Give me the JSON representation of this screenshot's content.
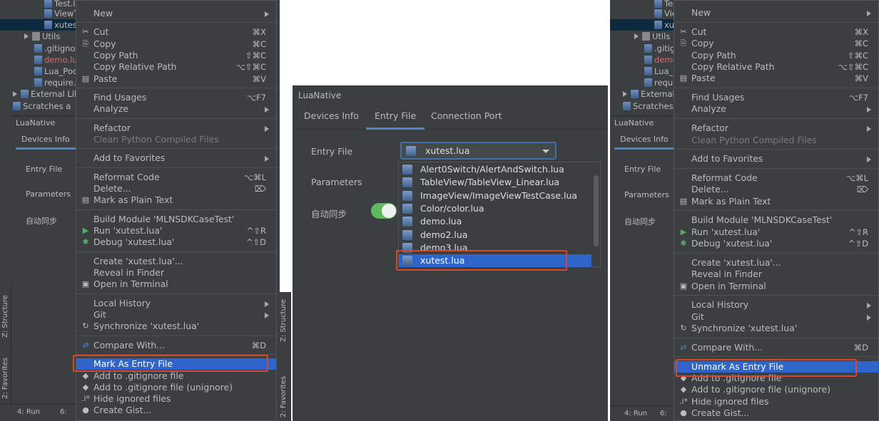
{
  "left": {
    "tree": [
      {
        "label": "Test.lua",
        "kind": "file"
      },
      {
        "label": "ViewT",
        "kind": "file"
      },
      {
        "label": "xutes",
        "kind": "file",
        "selected": true
      },
      {
        "label": "Utils",
        "kind": "folder"
      },
      {
        "label": ".gitignor",
        "kind": "file"
      },
      {
        "label": "demo.lua",
        "kind": "file",
        "red": true
      },
      {
        "label": "Lua_Pod",
        "kind": "file"
      },
      {
        "label": "require.s",
        "kind": "file"
      },
      {
        "label": "External Lib",
        "kind": "lib"
      },
      {
        "label": "Scratches a",
        "kind": "scratch"
      }
    ],
    "tool_title": "LuaNative",
    "tab": "Devices Info",
    "fields": [
      "Entry File",
      "Parameters",
      "自动同步"
    ],
    "vtabs": [
      "Z: Structure",
      "2: Favorites"
    ],
    "status": [
      "4: Run",
      "6:"
    ],
    "menu": [
      {
        "label": "New",
        "sub": true
      },
      {
        "sep": true
      },
      {
        "label": "Cut",
        "sc": "⌘X",
        "icon": "✂"
      },
      {
        "label": "Copy",
        "sc": "⌘C",
        "icon": "⎘"
      },
      {
        "label": "Copy Path",
        "sc": "⇧⌘C"
      },
      {
        "label": "Copy Relative Path",
        "sc": "⌥⇧⌘C"
      },
      {
        "label": "Paste",
        "sc": "⌘V",
        "icon": "▤"
      },
      {
        "sep": true
      },
      {
        "label": "Find Usages",
        "sc": "⌥F7"
      },
      {
        "label": "Analyze",
        "sub": true
      },
      {
        "sep": true
      },
      {
        "label": "Refactor",
        "sub": true
      },
      {
        "label": "Clean Python Compiled Files",
        "dis": true
      },
      {
        "sep": true
      },
      {
        "label": "Add to Favorites",
        "sub": true
      },
      {
        "sep": true
      },
      {
        "label": "Reformat Code",
        "sc": "⌥⌘L"
      },
      {
        "label": "Delete...",
        "sc": "⌦"
      },
      {
        "label": "Mark as Plain Text",
        "icon": "▤"
      },
      {
        "sep": true
      },
      {
        "label": "Build Module 'MLNSDKCaseTest'"
      },
      {
        "label": "Run 'xutest.lua'",
        "sc": "^⇧R",
        "icon": "▶",
        "iconColor": "#59a869"
      },
      {
        "label": "Debug 'xutest.lua'",
        "sc": "^⇧D",
        "icon": "✱",
        "iconColor": "#59a869"
      },
      {
        "sep": true
      },
      {
        "label": "Create 'xutest.lua'..."
      },
      {
        "label": "Reveal in Finder"
      },
      {
        "label": "Open in Terminal",
        "icon": "▣"
      },
      {
        "sep": true
      },
      {
        "label": "Local History",
        "sub": true
      },
      {
        "label": "Git",
        "sub": true
      },
      {
        "label": "Synchronize 'xutest.lua'",
        "icon": "↻"
      },
      {
        "sep": true
      },
      {
        "label": "Compare With...",
        "sc": "⌘D",
        "icon": "⇄",
        "iconColor": "#4a88c7"
      },
      {
        "sep": true
      },
      {
        "label": "Mark As Entry File",
        "hl": true
      },
      {
        "label": "Add to .gitignore file",
        "icon": "◆"
      },
      {
        "label": "Add to .gitignore file (unignore)",
        "icon": "◆"
      },
      {
        "label": "Hide ignored files",
        "icon": ".i*"
      },
      {
        "label": "Create Gist...",
        "icon": "●"
      }
    ]
  },
  "middle": {
    "title": "LuaNative",
    "tabs": [
      "Devices Info",
      "Entry File",
      "Connection Port"
    ],
    "active_tab": 1,
    "entry_label": "Entry File",
    "params_label": "Parameters",
    "sync_label": "自动同步",
    "combo_value": "xutest.lua",
    "toggle_on": true,
    "options": [
      "Alert0Switch/AlertAndSwitch.lua",
      "TableView/TableView_Linear.lua",
      "ImageView/ImageViewTestCase.lua",
      "Color/color.lua",
      "demo.lua",
      "demo2.lua",
      "demo3.lua",
      "xutest.lua"
    ],
    "selected_option": 7,
    "vtabs": [
      "Z: Structure",
      "2: Favorites"
    ]
  },
  "right": {
    "tree": [
      {
        "label": "Test.lua",
        "kind": "file"
      },
      {
        "label": "View",
        "kind": "file"
      },
      {
        "label": "xute",
        "kind": "file",
        "selected": true
      },
      {
        "label": "Utils",
        "kind": "folder"
      },
      {
        "label": ".gitigno",
        "kind": "file"
      },
      {
        "label": "demo.lu",
        "kind": "file",
        "red": true
      },
      {
        "label": "Lua_Poc",
        "kind": "file"
      },
      {
        "label": "require.",
        "kind": "file"
      },
      {
        "label": "External Lib",
        "kind": "lib"
      },
      {
        "label": "Scratches a",
        "kind": "scratch"
      }
    ],
    "tool_title": "LuaNative",
    "tab": "Devices Info",
    "fields": [
      "Entry File",
      "Parameters",
      "自动同步"
    ],
    "status": [
      "4: Run",
      "6:"
    ],
    "menu_highlight": "Unmark As Entry File"
  },
  "colors": {
    "highlight": "#2f65ca",
    "callout": "#d9472b",
    "panel": "#3c3f41"
  }
}
